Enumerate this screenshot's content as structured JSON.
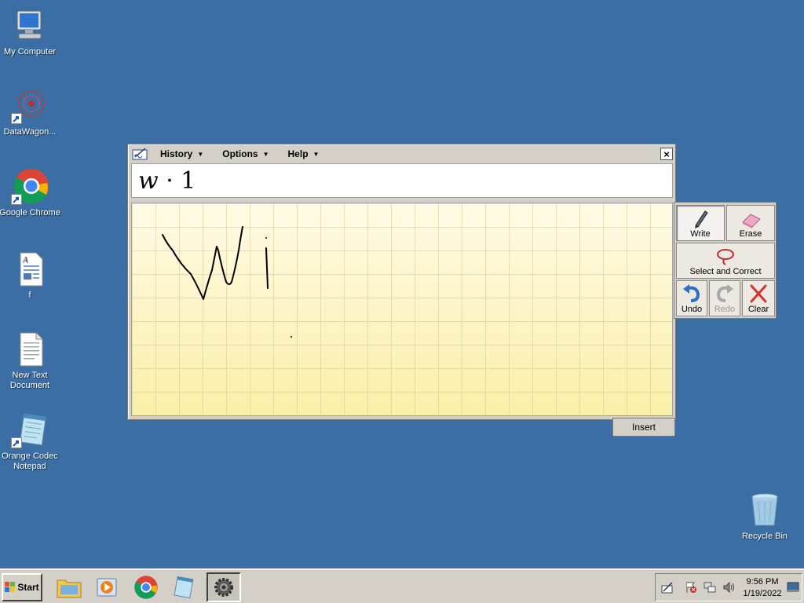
{
  "desktop": {
    "icons": [
      {
        "label": "My Computer"
      },
      {
        "label": "DataWagon..."
      },
      {
        "label": "Google Chrome"
      },
      {
        "label": "f"
      },
      {
        "label": "New Text Document"
      },
      {
        "label": "Orange Codec Notepad"
      },
      {
        "label": "Recycle Bin"
      }
    ]
  },
  "input_panel": {
    "menus": [
      {
        "label": "History"
      },
      {
        "label": "Options"
      },
      {
        "label": "Help"
      }
    ],
    "close_label": "×",
    "preview_text_italic": "w",
    "preview_text_rest": " · 1",
    "tools": {
      "write": "Write",
      "erase": "Erase",
      "select_correct": "Select and Correct",
      "undo": "Undo",
      "redo": "Redo",
      "clear": "Clear"
    },
    "insert_label": "Insert"
  },
  "taskbar": {
    "start_label": "Start",
    "clock_time": "9:56 PM",
    "clock_date": "1/19/2022"
  },
  "colors": {
    "desktop": "#3a6ea5",
    "pad": "#fdf6c8",
    "chrome": "#d4d0c8"
  }
}
